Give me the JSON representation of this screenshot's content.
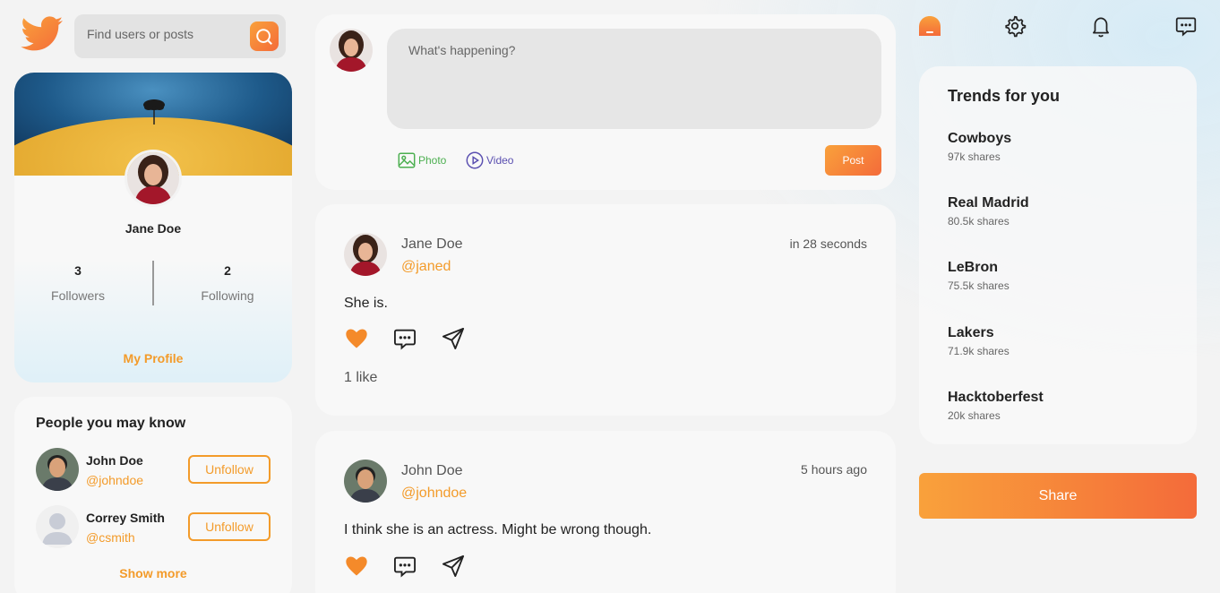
{
  "search": {
    "placeholder": "Find users or posts"
  },
  "profile": {
    "name": "Jane Doe",
    "followers_count": "3",
    "followers_label": "Followers",
    "following_count": "2",
    "following_label": "Following",
    "link_label": "My Profile"
  },
  "people": {
    "title": "People you may know",
    "items": [
      {
        "name": "John Doe",
        "handle": "@johndoe",
        "button": "Unfollow"
      },
      {
        "name": "Correy Smith",
        "handle": "@csmith",
        "button": "Unfollow"
      }
    ],
    "show_more": "Show more"
  },
  "composer": {
    "placeholder": "What's happening?",
    "photo_label": "Photo",
    "video_label": "Video",
    "post_label": "Post"
  },
  "posts": [
    {
      "author": "Jane Doe",
      "handle": "@janed",
      "time": "in 28 seconds",
      "body": "She is.",
      "likes": "1 like"
    },
    {
      "author": "John Doe",
      "handle": "@johndoe",
      "time": "5 hours ago",
      "body": "I think she is an actress. Might be wrong though."
    }
  ],
  "trends": {
    "title": "Trends for you",
    "items": [
      {
        "name": "Cowboys",
        "shares": "97k shares"
      },
      {
        "name": "Real Madrid",
        "shares": "80.5k shares"
      },
      {
        "name": "LeBron",
        "shares": "75.5k shares"
      },
      {
        "name": "Lakers",
        "shares": "71.9k shares"
      },
      {
        "name": "Hacktoberfest",
        "shares": "20k shares"
      }
    ]
  },
  "share_label": "Share",
  "icons": {
    "logo": "bird-logo-icon",
    "search": "search-icon",
    "top": [
      "home-icon",
      "gear-icon",
      "bell-icon",
      "chat-icon"
    ],
    "post_actions": [
      "heart-icon",
      "comment-icon",
      "send-icon"
    ]
  },
  "colors": {
    "accent": "#f39b2a",
    "accent_dark": "#f46b3a",
    "card": "#f8f8f8",
    "photo": "#4caf50",
    "video": "#5a4fb0"
  }
}
